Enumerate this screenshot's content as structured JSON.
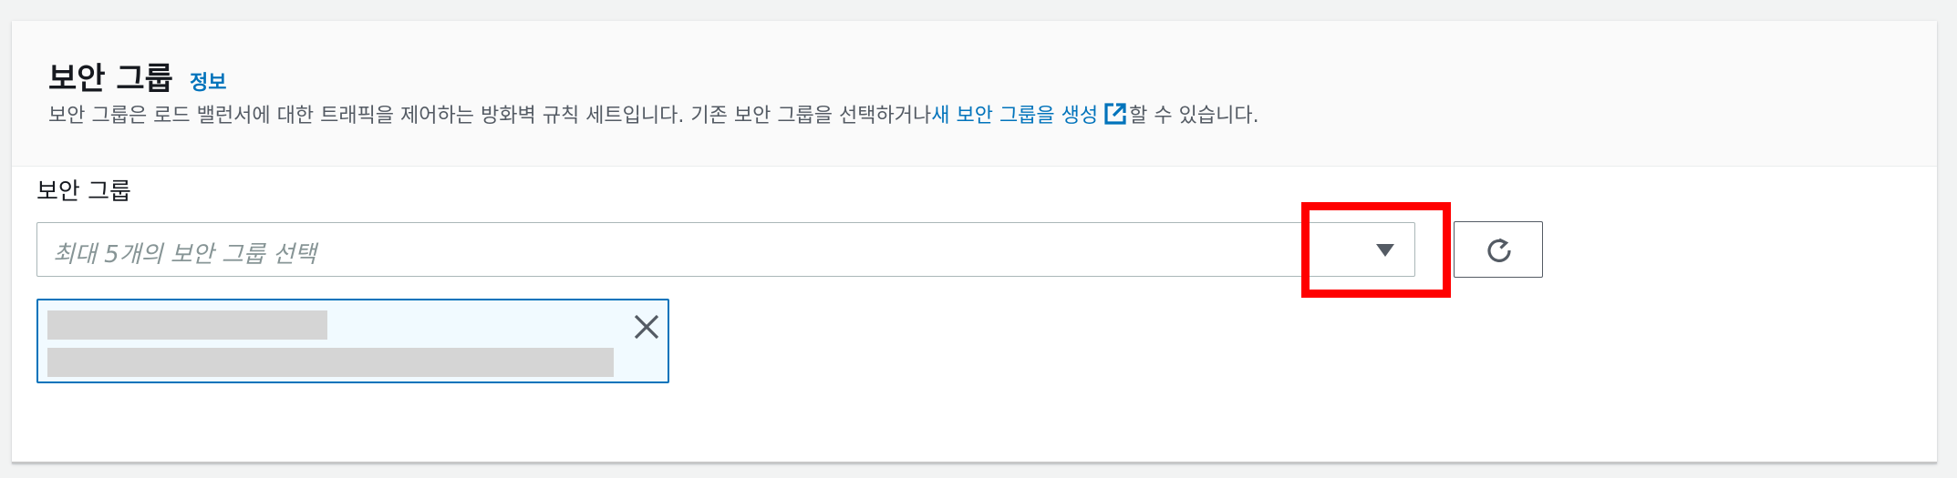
{
  "section": {
    "title": "보안 그룹",
    "info_link": "정보",
    "description_prefix": "보안 그룹은 로드 밸런서에 대한 트래픽을 제어하는 방화벽 규칙 세트입니다. 기존 보안 그룹을 선택하거나 ",
    "description_link": "새 보안 그룹을 생성",
    "description_suffix": "할 수 있습니다."
  },
  "field": {
    "label": "보안 그룹",
    "placeholder": "최대 5개의 보안 그룹 선택"
  },
  "icons": {
    "dropdown": "caret-down-icon",
    "refresh": "refresh-icon",
    "external": "external-link-icon",
    "dismiss": "close-icon"
  },
  "colors": {
    "link": "#0073bb",
    "highlight": "#ff0000",
    "token_background": "#f1faff",
    "token_border": "#0073bb"
  }
}
